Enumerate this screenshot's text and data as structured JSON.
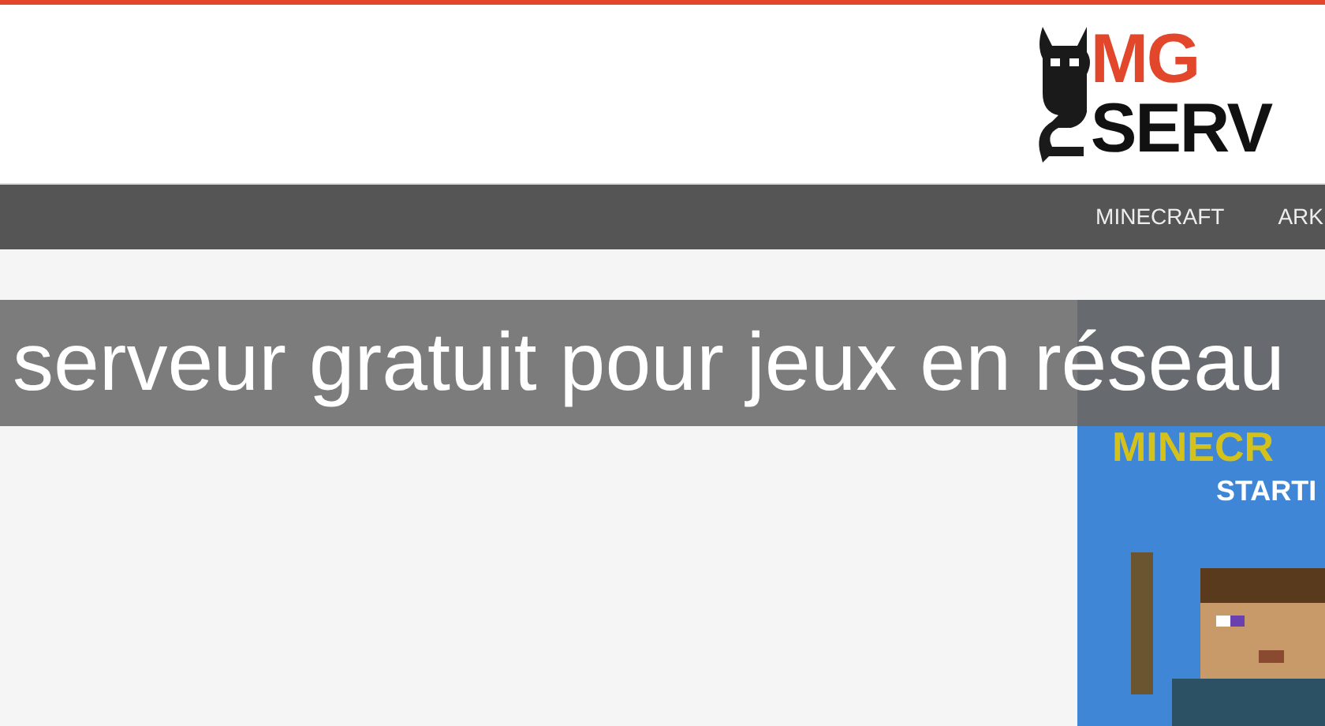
{
  "logo": {
    "top": "MG",
    "bottom": "SERV"
  },
  "nav": [
    {
      "label": "MINECRAFT"
    },
    {
      "label": "ARK"
    }
  ],
  "ad_banner": {
    "title": "MINECR",
    "subtitle": "STARTI"
  },
  "caption": "serveur gratuit pour jeux en réseau"
}
